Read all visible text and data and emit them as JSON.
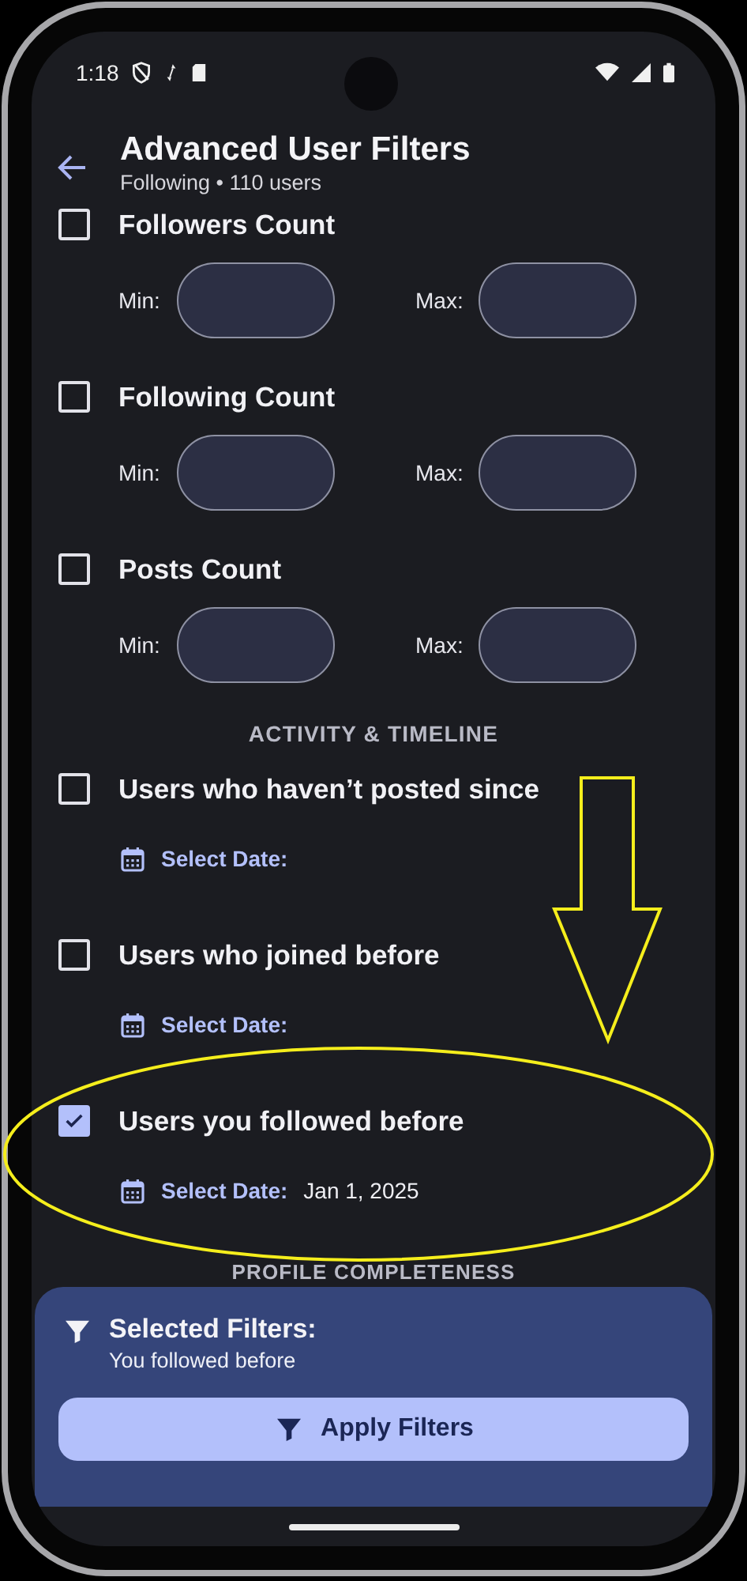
{
  "status_bar": {
    "time": "1:18"
  },
  "app_bar": {
    "title": "Advanced User Filters",
    "subtitle": "Following • 110 users"
  },
  "count_filters": [
    {
      "label": "Followers Count",
      "checked": false,
      "min_label": "Min:",
      "max_label": "Max:"
    },
    {
      "label": "Following Count",
      "checked": false,
      "min_label": "Min:",
      "max_label": "Max:"
    },
    {
      "label": "Posts Count",
      "checked": false,
      "min_label": "Min:",
      "max_label": "Max:"
    }
  ],
  "activity_section": "ACTIVITY & TIMELINE",
  "date_filters": [
    {
      "label": "Users who haven’t posted since",
      "checked": false,
      "date_label": "Select Date:"
    },
    {
      "label": "Users who joined before",
      "checked": false,
      "date_label": "Select Date:"
    },
    {
      "label": "Users you followed before",
      "checked": true,
      "date_label": "Select Date:",
      "date": "Jan 1, 2025"
    }
  ],
  "profile_section": "PROFILE COMPLETENESS",
  "summary": {
    "title": "Selected Filters:",
    "text": "You followed before",
    "button": "Apply Filters"
  }
}
